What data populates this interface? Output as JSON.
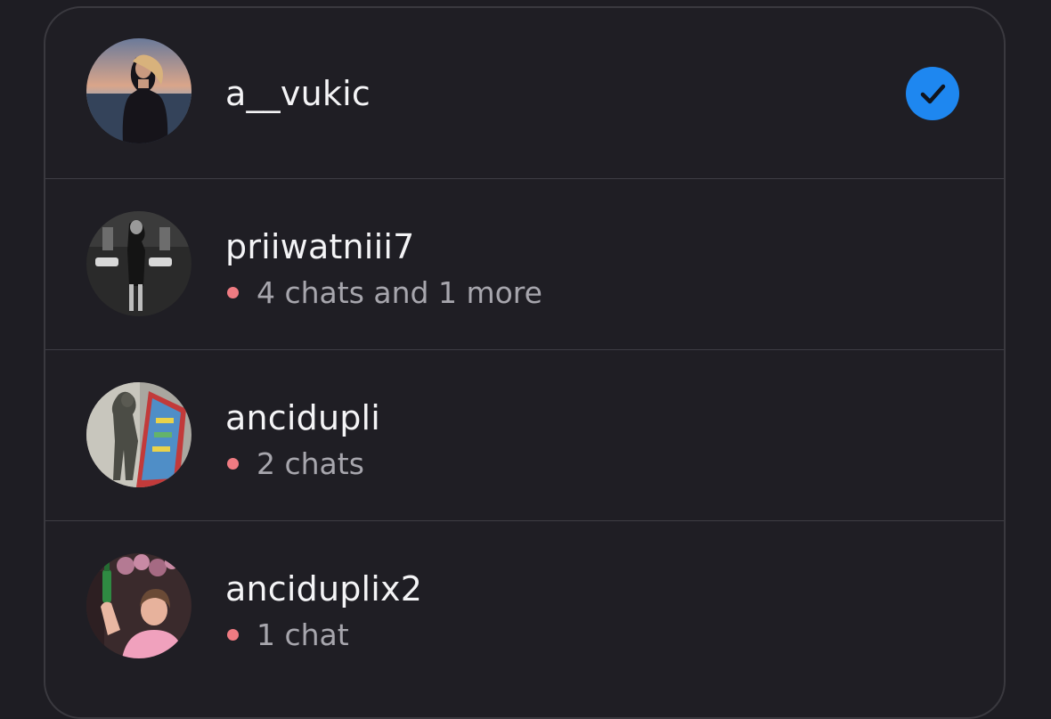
{
  "accounts": [
    {
      "username": "a__vukic",
      "status": "",
      "selected": true,
      "avatar": "avatar-sunset-photo"
    },
    {
      "username": "priiwatniii7",
      "status": "4 chats and 1 more",
      "selected": false,
      "avatar": "avatar-bw-mirror-photo"
    },
    {
      "username": "ancidupli",
      "status": "2 chats",
      "selected": false,
      "avatar": "avatar-vending-machine-photo"
    },
    {
      "username": "anciduplix2",
      "status": "1 chat",
      "selected": false,
      "avatar": "avatar-child-bottle-photo"
    }
  ],
  "colors": {
    "background": "#1e1d23",
    "unread_dot": "#ef7b82",
    "check_blue": "#1e87f0"
  },
  "icons": {
    "selected": "checkmark-circle-icon",
    "unread": "unread-dot-icon"
  }
}
